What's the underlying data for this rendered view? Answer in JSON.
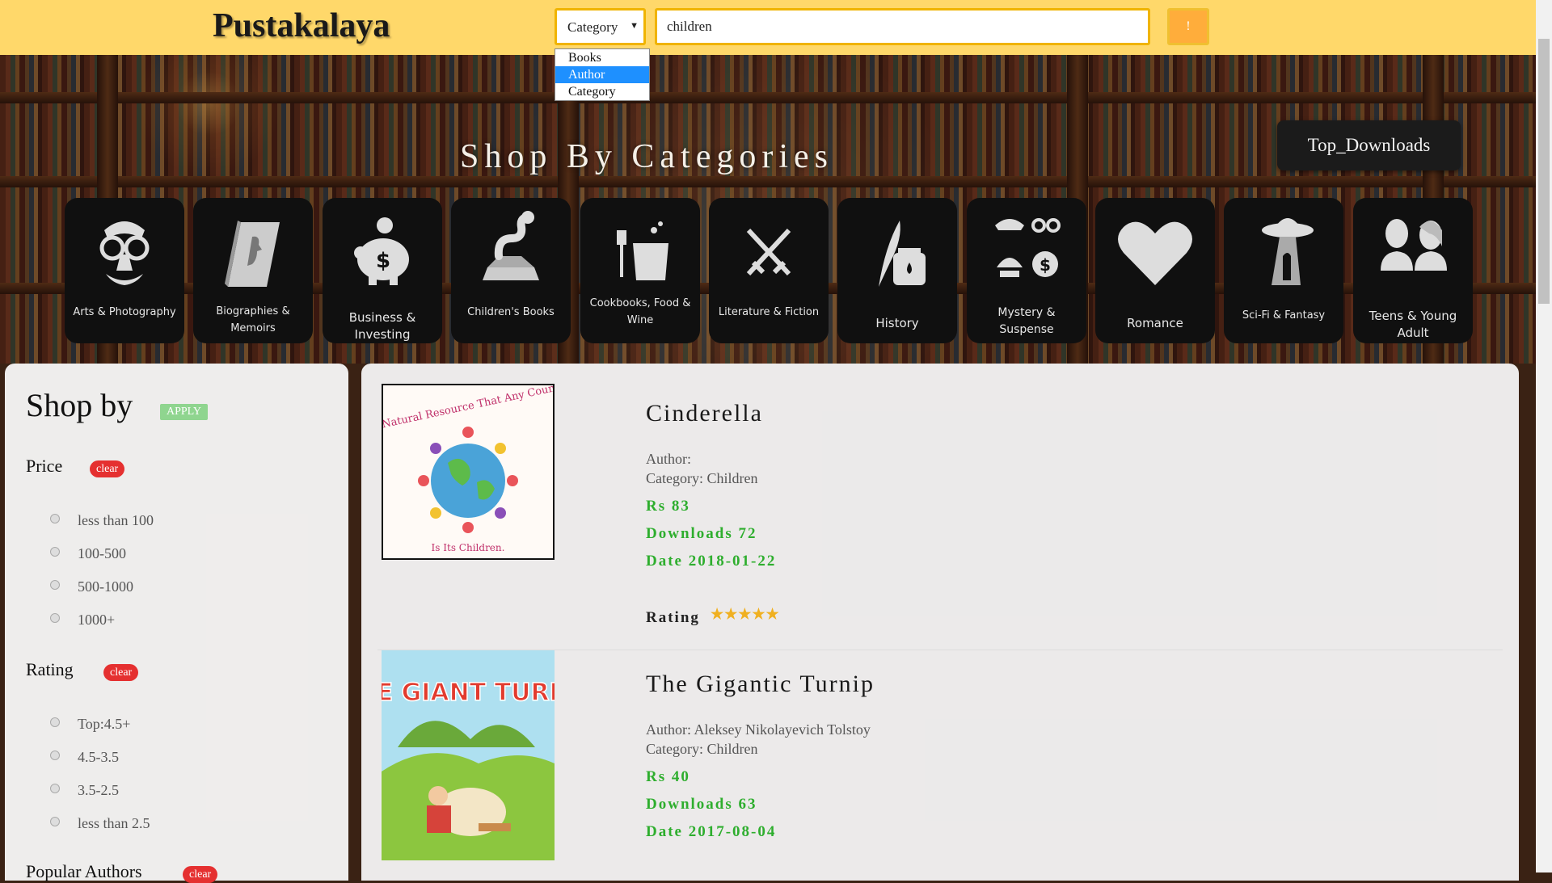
{
  "header": {
    "brand": "Pustakalaya",
    "search": {
      "category_selected": "Category",
      "query": "children",
      "button_label": "!"
    },
    "dropdown": {
      "options": [
        "Books",
        "Author",
        "Category"
      ],
      "highlighted": "Author"
    }
  },
  "hero": {
    "title": "Shop By Categories",
    "top_downloads_label": "Top_Downloads",
    "categories": [
      {
        "label": "Arts & Photography",
        "icon": "mask-icon"
      },
      {
        "label": "Biographies & Memoirs",
        "icon": "book-profile-icon"
      },
      {
        "label": "Business & Investing",
        "icon": "piggy-bank-icon"
      },
      {
        "label": "Children's Books",
        "icon": "snake-book-icon"
      },
      {
        "label": "Cookbooks, Food & Wine",
        "icon": "pot-icon"
      },
      {
        "label": "Literature & Fiction",
        "icon": "crossed-swords-icon"
      },
      {
        "label": "History",
        "icon": "quill-ink-icon"
      },
      {
        "label": "Mystery & Suspense",
        "icon": "detective-icon"
      },
      {
        "label": "Romance",
        "icon": "heart-icon"
      },
      {
        "label": "Sci-Fi & Fantasy",
        "icon": "ufo-icon"
      },
      {
        "label": "Teens & Young Adult",
        "icon": "people-icon"
      }
    ]
  },
  "filters": {
    "title": "Shop by",
    "apply_label": "APPLY",
    "clear_label": "clear",
    "price": {
      "title": "Price",
      "options": [
        "less than 100",
        "100-500",
        "500-1000",
        "1000+"
      ]
    },
    "rating": {
      "title": "Rating",
      "options": [
        "Top:4.5+",
        "4.5-3.5",
        "3.5-2.5",
        "less than 2.5"
      ]
    },
    "popular_authors": {
      "title": "Popular Authors"
    }
  },
  "results": [
    {
      "title": "Cinderella",
      "author": "Author:",
      "category": "Category: Children",
      "price": "Rs 83",
      "downloads": "Downloads 72",
      "date": "Date 2018-01-22",
      "rating_label": "Rating",
      "stars": "★★★★★",
      "cover_text": "The Greatest Natural Resource That Any Country Can Have",
      "cover_footer": "Is Its Children."
    },
    {
      "title": "The Gigantic Turnip",
      "author": "Author: Aleksey Nikolayevich Tolstoy",
      "category": "Category: Children",
      "price": "Rs 40",
      "downloads": "Downloads 63",
      "date": "Date 2017-08-04",
      "cover_text": "THE GIANT TURNIP"
    }
  ],
  "colors": {
    "topbar": "#ffd86a",
    "search_border": "#f0b400",
    "search_button": "#ffad3b",
    "accent_green": "#2eae2e",
    "clear_red": "#e53030",
    "apply_green": "#8fd58f",
    "dropdown_highlight": "#1e90ff"
  }
}
